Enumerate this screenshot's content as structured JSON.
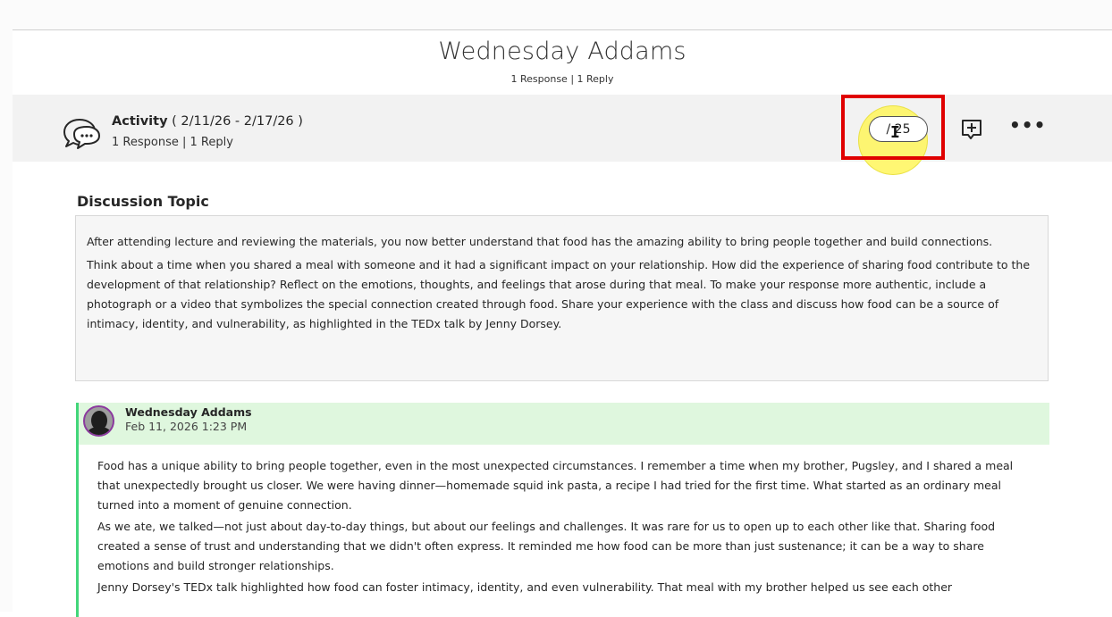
{
  "header": {
    "title": "Wednesday Addams",
    "subtitle": "1 Response | 1 Reply"
  },
  "activity": {
    "label": "Activity",
    "date_range": " ( 2/11/26 - 2/17/26 )",
    "stats": "1 Response | 1 Reply",
    "page_counter": "/ 25",
    "more_label": "•••"
  },
  "topic": {
    "heading": "Discussion Topic",
    "paragraphs": [
      "After attending lecture and reviewing the materials, you now better understand that food has the amazing ability to bring people together and build connections.",
      "Think about a time when you shared a meal with someone and it had a significant impact on your relationship. How did the experience of sharing food contribute to the development of that relationship? Reflect on the emotions, thoughts, and feelings that arose during that meal. To make your response more authentic, include a photograph or a video that symbolizes the special connection created through food. Share your experience with the class and discuss how food can be a source of intimacy, identity, and vulnerability, as highlighted in the TEDx talk by Jenny Dorsey."
    ]
  },
  "post": {
    "author": "Wednesday Addams",
    "date": "Feb 11, 2026 1:23 PM",
    "paragraphs": [
      "Food has a unique ability to bring people together, even in the most unexpected circumstances. I remember a time when my brother, Pugsley, and I shared a meal that unexpectedly brought us closer. We were having dinner—homemade squid ink pasta, a recipe I had tried for the first time. What started as an ordinary meal turned into a moment of genuine connection.",
      "As we ate, we talked—not just about day-to-day things, but about our feelings and challenges. It was rare for us to open up to each other like that. Sharing food created a sense of trust and understanding that we didn't often express. It reminded me how food can be more than just sustenance; it can be a way to share emotions and build stronger relationships.",
      "Jenny Dorsey's TEDx talk highlighted how food can foster intimacy, identity, and even vulnerability. That meal with my brother helped us see each other"
    ]
  },
  "colors": {
    "highlight": "#e00000",
    "cursor_halo": "#fff65a",
    "post_accent": "#42d67a",
    "post_header_bg": "#dff7de",
    "avatar_ring": "#8b3a9e"
  },
  "icons": {
    "discussion": "chat-bubbles-icon",
    "add_response": "add-comment-icon",
    "more": "more-options-icon"
  }
}
